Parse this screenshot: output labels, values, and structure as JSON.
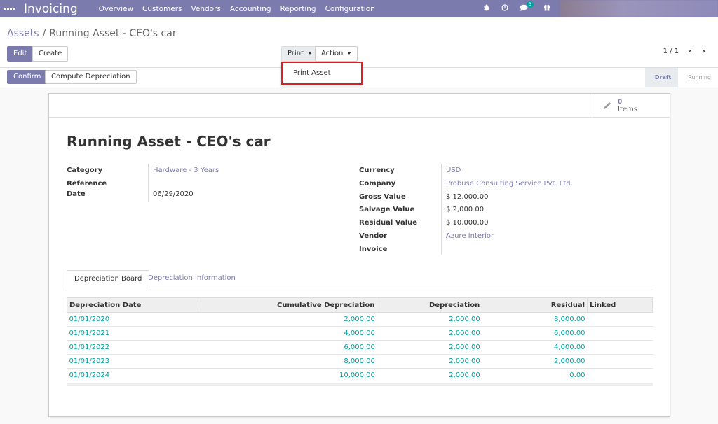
{
  "navbar": {
    "brand": "Invoicing",
    "menu": [
      "Overview",
      "Customers",
      "Vendors",
      "Accounting",
      "Reporting",
      "Configuration"
    ],
    "messages_badge": "3"
  },
  "breadcrumb": {
    "parent": "Assets",
    "separator": "/",
    "current": "Running Asset - CEO's car"
  },
  "toolbar": {
    "edit_label": "Edit",
    "create_label": "Create",
    "print_label": "Print",
    "action_label": "Action",
    "pager": "1 / 1"
  },
  "print_menu": {
    "items": [
      "Print Asset"
    ]
  },
  "statusbar": {
    "confirm_label": "Confirm",
    "compute_label": "Compute Depreciation",
    "stages": [
      "Draft",
      "Running"
    ],
    "active_stage": "Draft"
  },
  "smart_button": {
    "count": "0",
    "label": "Items"
  },
  "record": {
    "title": "Running Asset - CEO's car",
    "left_fields": [
      {
        "label": "Category",
        "value": "Hardware - 3 Years"
      },
      {
        "label": "Reference",
        "value": ""
      },
      {
        "label": "Date",
        "value": "06/29/2020"
      }
    ],
    "right_fields": [
      {
        "label": "Currency",
        "value": "USD"
      },
      {
        "label": "Company",
        "value": "Probuse Consulting Service Pvt. Ltd."
      },
      {
        "label": "Gross Value",
        "value": "$ 12,000.00"
      },
      {
        "label": "Salvage Value",
        "value": "$ 2,000.00"
      },
      {
        "label": "Residual Value",
        "value": "$ 10,000.00"
      },
      {
        "label": "Vendor",
        "value": "Azure Interior"
      },
      {
        "label": "Invoice",
        "value": ""
      }
    ]
  },
  "tabs": [
    "Depreciation Board",
    "Depreciation Information"
  ],
  "table": {
    "columns": [
      "Depreciation Date",
      "Cumulative Depreciation",
      "Depreciation",
      "Residual",
      "Linked"
    ],
    "rows": [
      [
        "01/01/2020",
        "2,000.00",
        "2,000.00",
        "8,000.00",
        ""
      ],
      [
        "01/01/2021",
        "4,000.00",
        "2,000.00",
        "6,000.00",
        ""
      ],
      [
        "01/01/2022",
        "6,000.00",
        "2,000.00",
        "4,000.00",
        ""
      ],
      [
        "01/01/2023",
        "8,000.00",
        "2,000.00",
        "2,000.00",
        ""
      ],
      [
        "01/01/2024",
        "10,000.00",
        "2,000.00",
        "0.00",
        ""
      ]
    ]
  },
  "colors": {
    "brand": "#7c7bad",
    "link_teal": "#00a09d",
    "highlight": "#e02020"
  }
}
